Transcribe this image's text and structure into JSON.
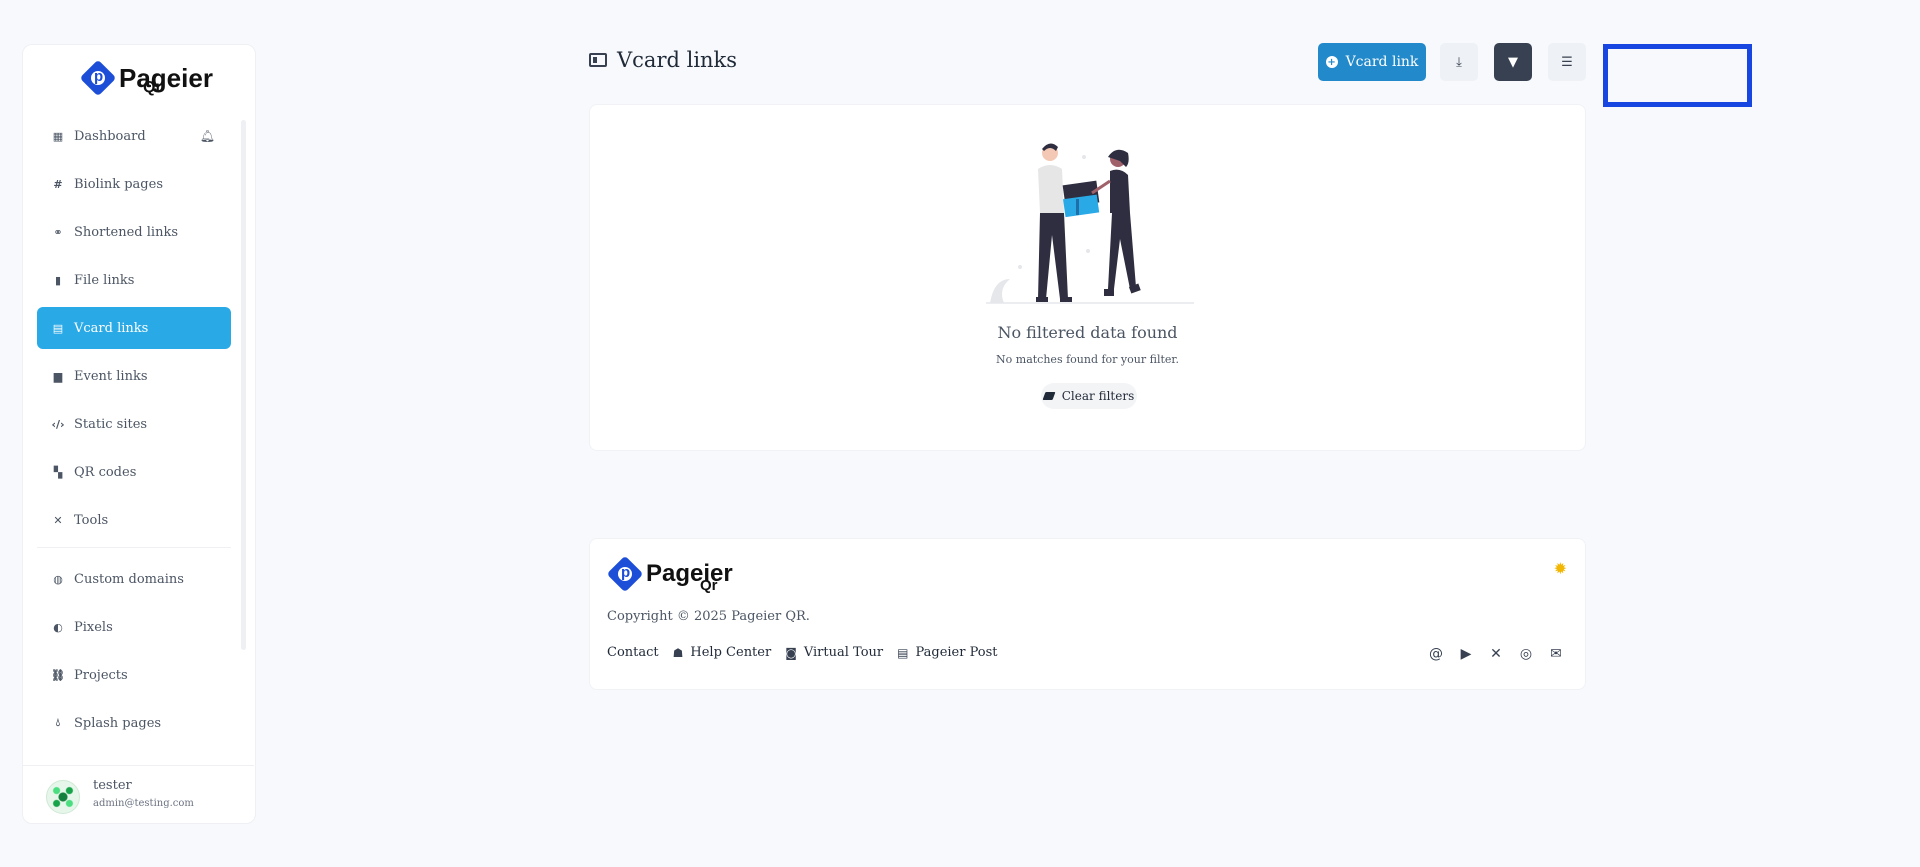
{
  "brand": {
    "name": "Pageier",
    "sub": "Qr"
  },
  "sidebar": {
    "items": [
      {
        "label": "Dashboard",
        "icon": "table-icon"
      },
      {
        "label": "Biolink pages",
        "icon": "hash-icon"
      },
      {
        "label": "Shortened links",
        "icon": "link-icon"
      },
      {
        "label": "File links",
        "icon": "file-icon"
      },
      {
        "label": "Vcard links",
        "icon": "id-card-icon",
        "active": true
      },
      {
        "label": "Event links",
        "icon": "calendar-icon"
      },
      {
        "label": "Static sites",
        "icon": "code-icon"
      },
      {
        "label": "QR codes",
        "icon": "qrcode-icon"
      },
      {
        "label": "Tools",
        "icon": "tools-icon"
      },
      {
        "label": "Custom domains",
        "icon": "globe-icon"
      },
      {
        "label": "Pixels",
        "icon": "adjust-icon"
      },
      {
        "label": "Projects",
        "icon": "project-diagram-icon"
      },
      {
        "label": "Splash pages",
        "icon": "droplet-icon"
      }
    ]
  },
  "user": {
    "name": "tester",
    "email": "admin@testing.com"
  },
  "header": {
    "title": "Vcard links",
    "create_label": "Vcard link"
  },
  "empty_state": {
    "title": "No filtered data found",
    "subtitle": "No matches found for your filter.",
    "clear_label": "Clear filters"
  },
  "footer": {
    "copyright": "Copyright © 2025 Pageier QR.",
    "links": [
      {
        "label": "Contact",
        "icon": ""
      },
      {
        "label": "Help Center",
        "icon": "hands-helping-icon"
      },
      {
        "label": "Virtual Tour",
        "icon": "vr-cardboard-icon"
      },
      {
        "label": "Pageier Post",
        "icon": "id-card-icon"
      }
    ],
    "socials": [
      "threads-icon",
      "youtube-icon",
      "x-icon",
      "instagram-icon",
      "email-icon"
    ]
  },
  "colors": {
    "accent": "#29a9e6",
    "primary_button": "#2289cb",
    "highlight": "#1747e0"
  }
}
